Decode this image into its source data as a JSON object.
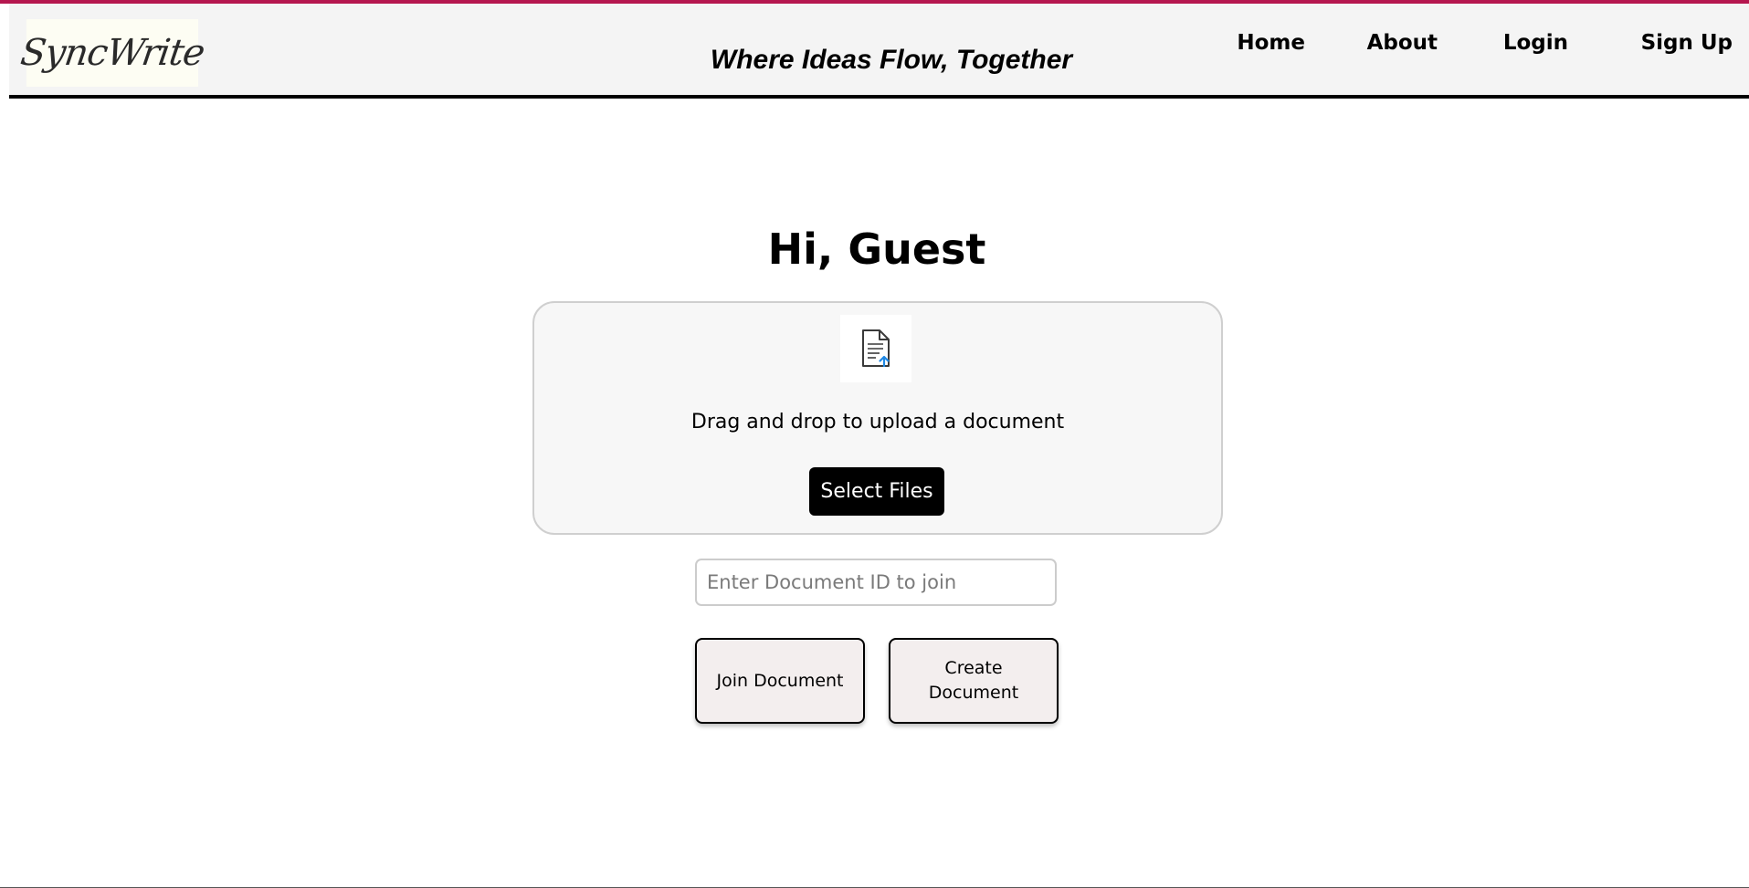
{
  "brand": {
    "logo_text": "SyncWrite",
    "tagline": "Where Ideas Flow, Together",
    "accent_color": "#b5174f"
  },
  "nav": {
    "items": [
      "Home",
      "About",
      "Login",
      "Sign Up"
    ]
  },
  "main": {
    "greeting": "Hi, Guest",
    "upload": {
      "icon": "document-upload-icon",
      "prompt": "Drag and drop to upload a document",
      "select_label": "Select Files"
    },
    "doc_id_input": {
      "placeholder": "Enter Document ID to join",
      "value": ""
    },
    "join_label": "Join Document",
    "create_label": "Create Document"
  }
}
